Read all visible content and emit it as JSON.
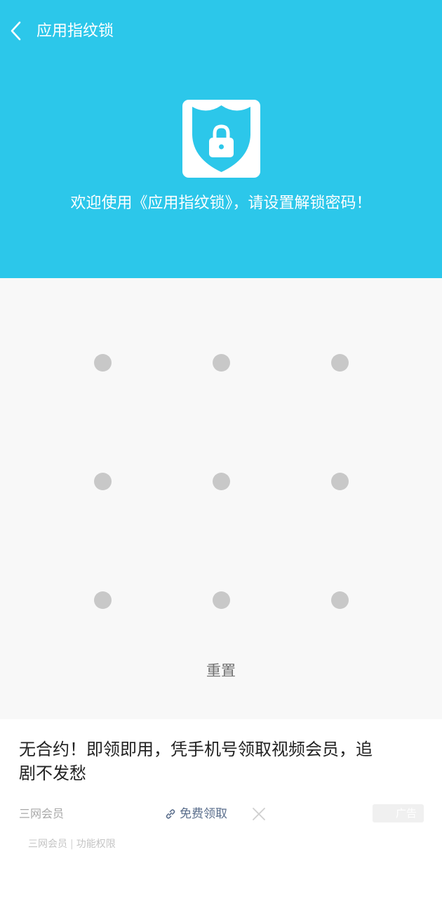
{
  "header": {
    "title": "应用指纹锁",
    "welcome_text": "欢迎使用《应用指纹锁》，请设置解锁密码！",
    "background_color": "#2cc7ea",
    "icons": {
      "back": "chevron-left-icon",
      "logo": "shield-lock-icon"
    }
  },
  "pattern": {
    "rows": 3,
    "cols": 3,
    "dot_color": "#c8c8c8",
    "background_color": "#f8f8f8"
  },
  "reset_label": "重置",
  "ad": {
    "headline": "无合约！即领即用，凭手机号领取视频会员，追剧不发愁",
    "source": "三网会员",
    "cta_label": "免费领取",
    "badge": "广告",
    "footer_brand": "三网会员",
    "footer_separator": "|",
    "footer_link": "功能权限",
    "icons": {
      "cta": "link-icon",
      "close": "close-icon"
    }
  }
}
